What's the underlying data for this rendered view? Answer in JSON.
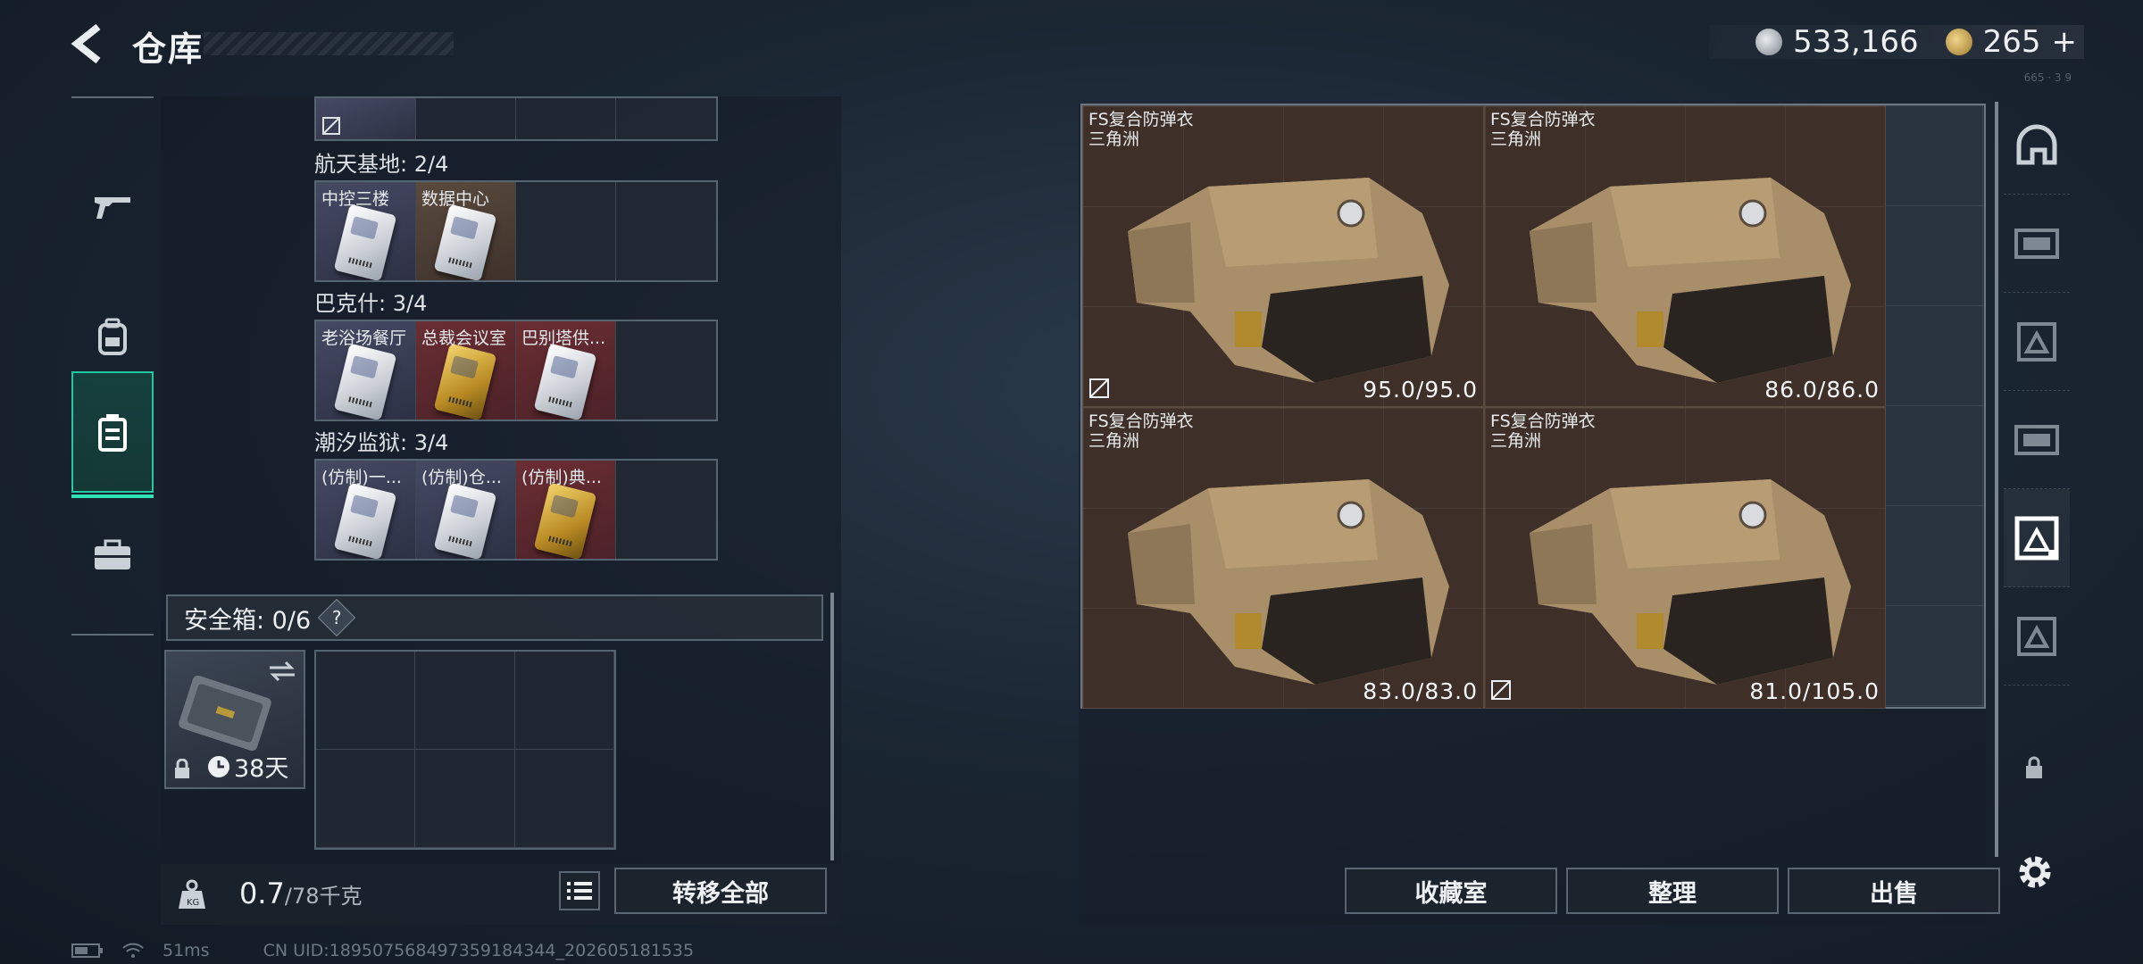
{
  "header": {
    "title": "仓库",
    "currency_primary": "533,166",
    "currency_secondary": "265",
    "currency_add": "+",
    "version_text": "665 · 3 9"
  },
  "storage": {
    "sections": [
      {
        "title": "航天基地: 2/4",
        "cards": [
          {
            "label": "中控三楼",
            "rarity": "white",
            "card": "white"
          },
          {
            "label": "数据中心",
            "rarity": "brown",
            "card": "white"
          }
        ]
      },
      {
        "title": "巴克什: 3/4",
        "cards": [
          {
            "label": "老浴场餐厅",
            "rarity": "white",
            "card": "white"
          },
          {
            "label": "总裁会议室",
            "rarity": "red",
            "card": "gold"
          },
          {
            "label": "巴别塔供...",
            "rarity": "red",
            "card": "white"
          }
        ]
      },
      {
        "title": "潮汐监狱: 3/4",
        "cards": [
          {
            "label": "(仿制)一...",
            "rarity": "white",
            "card": "white"
          },
          {
            "label": "(仿制)仓...",
            "rarity": "white",
            "card": "white"
          },
          {
            "label": "(仿制)典...",
            "rarity": "red",
            "card": "gold"
          }
        ]
      }
    ],
    "safe_box": {
      "label": "安全箱: 0/6",
      "help": "?",
      "days": "38天"
    },
    "weight_current": "0.7",
    "weight_max": "/78千克",
    "transfer_all": "转移全部"
  },
  "armor": {
    "items": [
      {
        "name": "FS复合防弹衣",
        "sub": "三角洲",
        "durability": "95.0/95.0"
      },
      {
        "name": "FS复合防弹衣",
        "sub": "三角洲",
        "durability": "86.0/86.0"
      },
      {
        "name": "FS复合防弹衣",
        "sub": "三角洲",
        "durability": "83.0/83.0"
      },
      {
        "name": "FS复合防弹衣",
        "sub": "三角洲",
        "durability": "81.0/105.0"
      }
    ]
  },
  "actions": {
    "collection": "收藏室",
    "organize": "整理",
    "sell": "出售"
  },
  "status": {
    "ping": "51ms",
    "uid": "CN UID:189507568497359184344_202605181535"
  },
  "colors": {
    "accent": "#2ee2b4",
    "armor_bg": "#3e3029",
    "panel_border": "#566370"
  }
}
